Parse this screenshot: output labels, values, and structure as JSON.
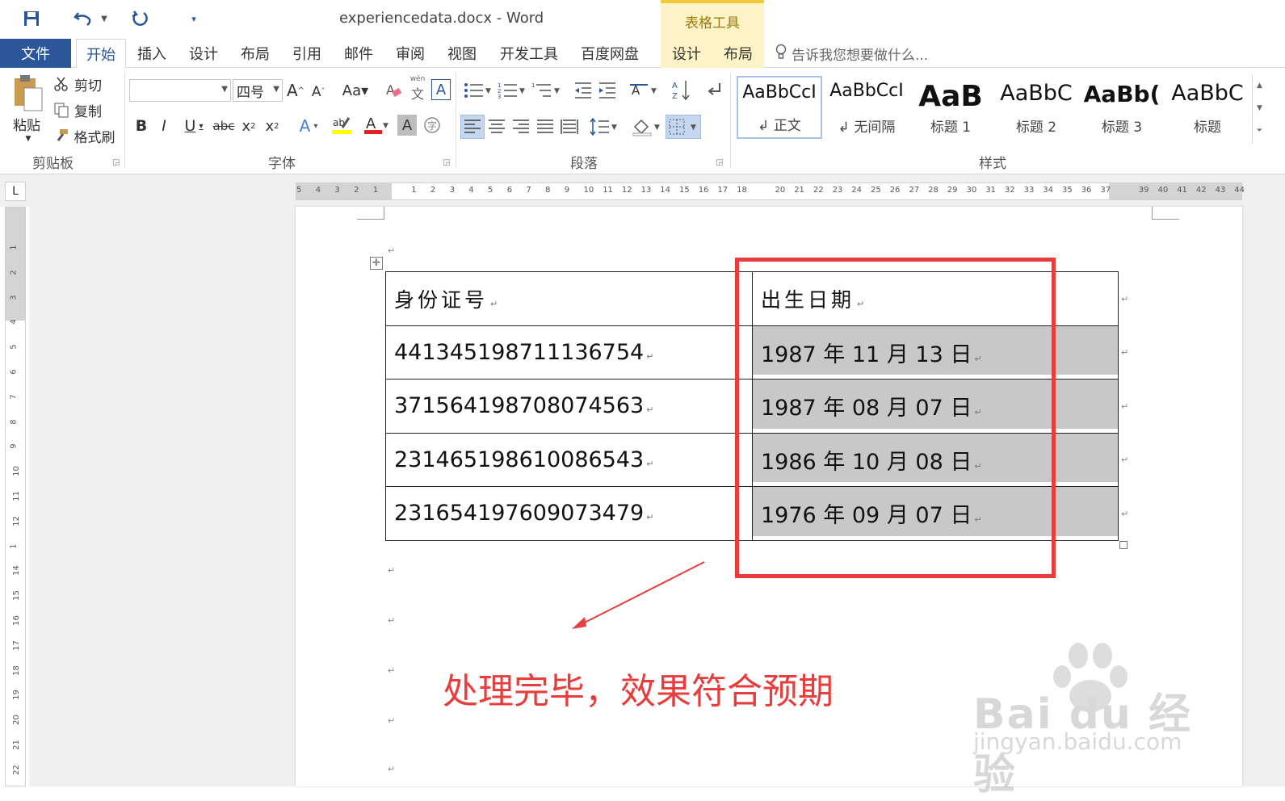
{
  "window": {
    "title": "experiencedata.docx - Word",
    "contextual_tab_group": "表格工具"
  },
  "tabs": [
    "文件",
    "开始",
    "插入",
    "设计",
    "布局",
    "引用",
    "邮件",
    "审阅",
    "视图",
    "开发工具",
    "百度网盘",
    "设计",
    "布局"
  ],
  "tell_me": "告诉我您想要做什么...",
  "ribbon": {
    "clipboard": {
      "paste": "粘贴",
      "cut": "剪切",
      "copy": "复制",
      "format_painter": "格式刷",
      "label": "剪贴板"
    },
    "font": {
      "font_name": "",
      "font_size": "四号",
      "label": "字体"
    },
    "paragraph": {
      "label": "段落"
    },
    "styles": {
      "label": "样式",
      "items": [
        {
          "sample": "AaBbCcI",
          "name": "↲ 正文"
        },
        {
          "sample": "AaBbCcI",
          "name": "↲ 无间隔"
        },
        {
          "sample": "AaB",
          "name": "标题 1"
        },
        {
          "sample": "AaBbC",
          "name": "标题 2"
        },
        {
          "sample": "AaBb(",
          "name": "标题 3"
        },
        {
          "sample": "AaBbC",
          "name": "标题"
        }
      ]
    }
  },
  "ruler": {
    "h_ticks": [
      "5",
      "4",
      "3",
      "2",
      "1",
      "",
      "1",
      "2",
      "3",
      "4",
      "5",
      "6",
      "7",
      "8",
      "9",
      "10",
      "11",
      "12",
      "13",
      "14",
      "15",
      "16",
      "17",
      "18",
      "",
      "20",
      "21",
      "22",
      "23",
      "24",
      "25",
      "26",
      "27",
      "28",
      "29",
      "30",
      "31",
      "32",
      "33",
      "34",
      "35",
      "36",
      "37",
      "",
      "39",
      "40",
      "41",
      "42",
      "43",
      "44"
    ],
    "v_ticks": [
      "1",
      "2",
      "3",
      "4",
      "5",
      "6",
      "7",
      "8",
      "9",
      "10",
      "11",
      "12",
      "1",
      "14",
      "15",
      "16",
      "17",
      "18",
      "19",
      "20",
      "21",
      "22"
    ]
  },
  "table": {
    "header": [
      "身份证号",
      "出生日期"
    ],
    "rows": [
      [
        "441345198711136754",
        "1987 年 11 月 13 日"
      ],
      [
        "371564198708074563",
        "1987 年 08 月 07 日"
      ],
      [
        "231465198610086543",
        "1986 年 10 月 08 日"
      ],
      [
        "231654197609073479",
        "1976 年 09 月 07 日"
      ]
    ]
  },
  "annotation": "处理完毕，效果符合预期",
  "watermark": {
    "text": "Bai du 经验",
    "sub": "jingyan.baidu.com"
  },
  "colors": {
    "accent": "#2b579a",
    "annotation_red": "#e83d3d",
    "table_tools": "#fdf3c6"
  }
}
